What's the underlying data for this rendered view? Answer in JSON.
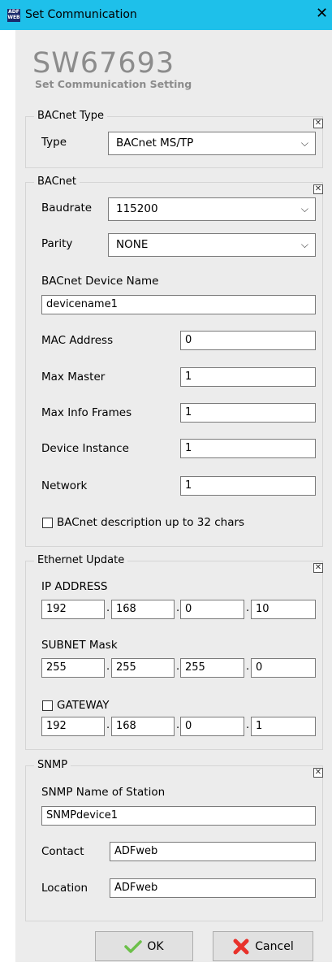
{
  "window": {
    "title": "Set Communication",
    "close_glyph": "✕",
    "icon_text_top": "ADF",
    "icon_text_bottom": "WEB"
  },
  "header": {
    "model": "SW67693",
    "subtitle": "Set Communication Setting"
  },
  "bacnet_type": {
    "group_title": "BACnet Type",
    "type_label": "Type",
    "type_value": "BACnet MS/TP"
  },
  "bacnet": {
    "group_title": "BACnet",
    "baudrate_label": "Baudrate",
    "baudrate_value": "115200",
    "parity_label": "Parity",
    "parity_value": "NONE",
    "device_name_label": "BACnet Device Name",
    "device_name_value": "devicename1",
    "mac_label": "MAC Address",
    "mac_value": "0",
    "max_master_label": "Max Master",
    "max_master_value": "1",
    "max_info_frames_label": "Max Info Frames",
    "max_info_frames_value": "1",
    "device_instance_label": "Device Instance",
    "device_instance_value": "1",
    "network_label": "Network",
    "network_value": "1",
    "desc32_label": "BACnet description up to 32 chars",
    "desc32_checked": false
  },
  "ethernet": {
    "group_title": "Ethernet Update",
    "ip_label": "IP ADDRESS",
    "ip": [
      "192",
      "168",
      "0",
      "10"
    ],
    "subnet_label": "SUBNET Mask",
    "subnet": [
      "255",
      "255",
      "255",
      "0"
    ],
    "gateway_label": "GATEWAY",
    "gateway_checked": false,
    "gateway": [
      "192",
      "168",
      "0",
      "1"
    ]
  },
  "snmp": {
    "group_title": "SNMP",
    "station_label": "SNMP Name of Station",
    "station_value": "SNMPdevice1",
    "contact_label": "Contact",
    "contact_value": "ADFweb",
    "location_label": "Location",
    "location_value": "ADFweb"
  },
  "buttons": {
    "ok_label": "OK",
    "cancel_label": "Cancel"
  },
  "colors": {
    "titlebar": "#1ec0ea",
    "background": "#ececec",
    "heading": "#8c8c8c",
    "ok_check": "#6cc04a",
    "cancel_x": "#e8312a"
  },
  "icons": {
    "dropdown": "chevron-down-icon",
    "group_close": "close-box-icon",
    "ok": "checkmark-icon",
    "cancel": "cancel-x-icon"
  },
  "glyphs": {
    "chevron": "⌵",
    "xbox": "✕",
    "octet_dot": "."
  }
}
